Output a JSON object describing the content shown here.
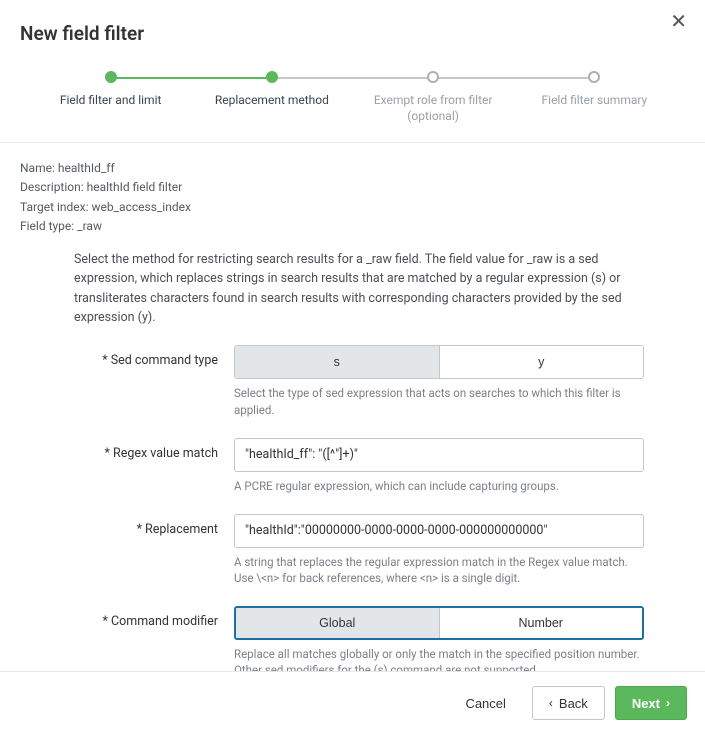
{
  "title": "New field filter",
  "close_icon": "✕",
  "steps": [
    {
      "label": "Field filter and limit",
      "state": "done"
    },
    {
      "label": "Replacement method",
      "state": "active"
    },
    {
      "label": "Exempt role from filter (optional)",
      "state": "upcoming"
    },
    {
      "label": "Field filter summary",
      "state": "upcoming"
    }
  ],
  "meta": {
    "name_label": "Name:",
    "name_value": "healthId_ff",
    "desc_label": "Description:",
    "desc_value": "healthId field filter",
    "index_label": "Target index:",
    "index_value": "web_access_index",
    "type_label": "Field type:",
    "type_value": "_raw"
  },
  "intro": "Select the method for restricting search results for a _raw field. The field value for _raw is a sed expression, which replaces strings in search results that are matched by a regular expression (s) or transliterates characters found in search results with corresponding characters provided by the sed expression (y).",
  "fields": {
    "sed_label": "Sed command type",
    "sed_opts": {
      "s": "s",
      "y": "y"
    },
    "sed_help": "Select the type of sed expression that acts on searches to which this filter is applied.",
    "regex_label": "Regex value match",
    "regex_value": "\"healthId_ff\": \"([^\"]+)\"",
    "regex_help": "A PCRE regular expression, which can include capturing groups.",
    "repl_label": "Replacement",
    "repl_value": "\"healthId\":\"00000000-0000-0000-0000-000000000000\"",
    "repl_help": "A string that replaces the regular expression match in the Regex value match. Use \\<n> for back references, where <n> is a single digit.",
    "mod_label": "Command modifier",
    "mod_opts": {
      "global": "Global",
      "number": "Number"
    },
    "mod_help": "Replace all matches globally or only the match in the specified position number. Other sed modifiers for the (s) command are not supported."
  },
  "footer": {
    "cancel": "Cancel",
    "back": "Back",
    "next": "Next"
  }
}
